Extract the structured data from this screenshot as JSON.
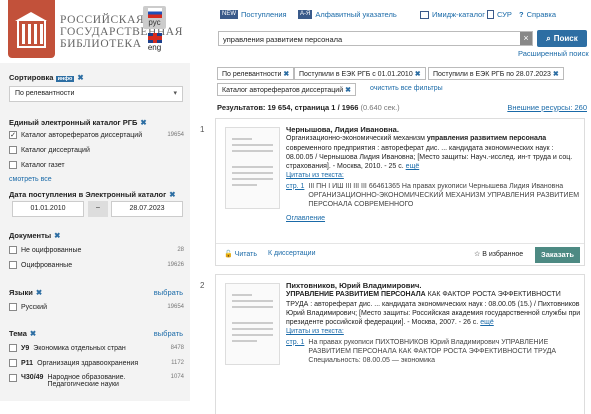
{
  "header": {
    "library_lines": [
      "РОССИЙСКАЯ",
      "ГОСУДАРСТВЕННАЯ",
      "БИБЛИОТЕКА"
    ],
    "lang_ru": "рус",
    "lang_en": "eng",
    "nav": [
      {
        "icon": "NEW",
        "label": "Поступления"
      },
      {
        "icon": "А-Я",
        "label": "Алфавитный указатель"
      },
      {
        "icon": "",
        "label": "Имидж-каталог"
      },
      {
        "icon": "",
        "label": "СУР"
      },
      {
        "icon": "?",
        "label": "Справка"
      }
    ],
    "search_value": "управления развитием персонала",
    "search_button": "Поиск",
    "advanced": "Расширенный поиск"
  },
  "sidebar": {
    "sort_label": "Сортировка",
    "sort_tag": "инфо",
    "sort_value": "По релевантности",
    "catalog_label": "Единый электронный каталог РГБ",
    "catalogs": [
      {
        "label": "Каталог авторефератов диссертаций",
        "count": "19654",
        "checked": true
      },
      {
        "label": "Каталог диссертаций",
        "count": "",
        "checked": false
      },
      {
        "label": "Каталог газет",
        "count": "",
        "checked": false
      }
    ],
    "show_all": "смотреть все",
    "date_label": "Дата поступления в Электронный каталог",
    "date_from": "01.01.2010",
    "date_sep": "–",
    "date_to": "28.07.2023",
    "docs_label": "Документы",
    "docs": [
      {
        "label": "Не оцифрованные",
        "count": "28"
      },
      {
        "label": "Оцифрованные",
        "count": "19626"
      }
    ],
    "lang_label": "Языки",
    "choose": "выбрать",
    "langs": [
      {
        "label": "Русский",
        "count": "19654"
      }
    ],
    "topic_label": "Тема",
    "topics": [
      {
        "code": "У9",
        "label": "Экономика отдельных стран",
        "count": "8478"
      },
      {
        "code": "Р11",
        "label": "Организация здравоохранения",
        "count": "1172"
      },
      {
        "code": "Ч30/49",
        "label": "Народное образование. Педагогические науки",
        "count": "1074"
      }
    ]
  },
  "filters": {
    "chips": [
      "По релевантности",
      "Поступили в ЕЭК РГБ с 01.01.2010",
      "Поступили в ЕЭК РГБ по 28.07.2023",
      "Каталог авторефератов диссертаций"
    ],
    "clear": "очистить все фильтры"
  },
  "results": {
    "summary": "Результатов: 19 654, страница 1 / 1966",
    "time": "(0.640 сек.)",
    "external": "Внешние ресурсы: 260",
    "items": [
      {
        "n": "1",
        "author": "Чернышова, Лидия Ивановна.",
        "title_pre": "Организационно-экономический механизм ",
        "title_bold": "управления развитием персонала",
        "rest": " современного предприятия : автореферат дис. ... кандидата экономических наук : 08.00.05 / Чернышова Лидия Ивановна; [Место защиты: Науч.-исслед. ин-т труда и соц. страхования]. - Москва, 2010. - 25 с.",
        "more": "ещё",
        "quotes": "Цитаты из текста:",
        "page": "стр. 1",
        "quote": "III ПН I ИШ III III III 66461365 На правах рукописи Чернышева Лидия Ивановна ОРГАНИЗАЦИОННО-ЭКОНОМИЧЕСКИЙ МЕХАНИЗМ УПРАВЛЕНИЯ РАЗВИТИЕМ ПЕРСОНАЛА СОВРЕМЕННОГО",
        "contents": "Оглавление",
        "read": "Читать",
        "to_diss": "К диссертации",
        "fav": "В избранное",
        "order": "Заказать"
      },
      {
        "n": "2",
        "author": "Пихтовников, Юрий Владимирович.",
        "title_bold": "УПРАВЛЕНИЕ РАЗВИТИЕМ ПЕРСОНАЛА",
        "title_pre": "",
        "rest": " КАК ФАКТОР РОСТА ЭФФЕКТИВНОСТИ ТРУДА : автореферат дис. ... кандидата экономических наук : 08.00.05 (15.) / Пихтовников Юрий Владимирович; [Место защиты: Российская академия государственной службы при президенте российской федерации]. - Москва, 2007. - 26 с.",
        "more": "ещё",
        "quotes": "Цитаты из текста:",
        "page": "стр. 1",
        "quote": "На правах рукописи ПИХТОВНИКОВ Юрий Владимирович УПРАВЛЕНИЕ РАЗВИТИЕМ ПЕРСОНАЛА КАК ФАКТОР РОСТА ЭФФЕКТИВНОСТИ ТРУДА Специальность: 08.00.05 — экономика",
        "contents": "Оглавление"
      }
    ]
  },
  "colors": {
    "brand": "#c2513a",
    "accent": "#2d6ea3",
    "order": "#4d8a83"
  }
}
